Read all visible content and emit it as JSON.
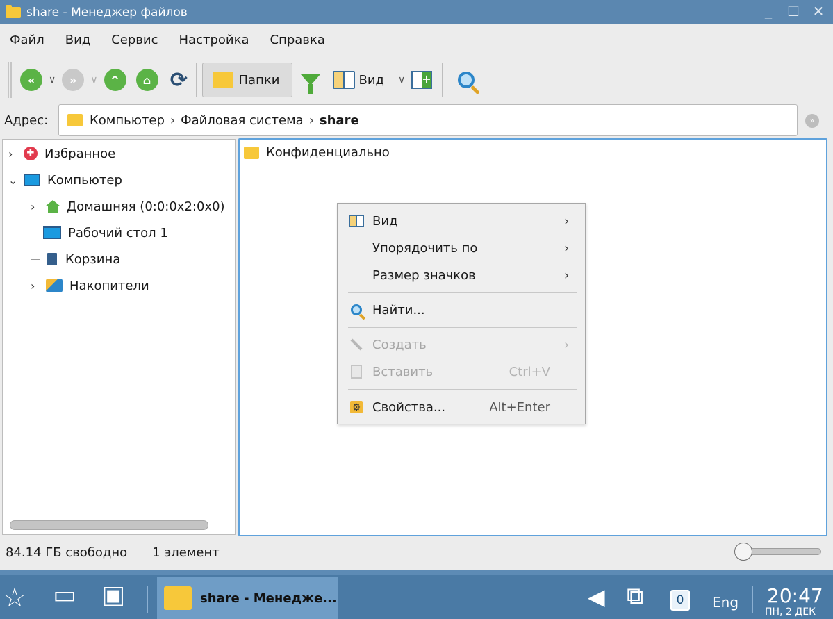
{
  "window": {
    "title": "share - Менеджер файлов",
    "controls": [
      "_",
      "☐",
      "✕"
    ]
  },
  "menubar": {
    "items": [
      "Файл",
      "Вид",
      "Сервис",
      "Настройка",
      "Справка"
    ]
  },
  "toolbar": {
    "folders_label": "Папки",
    "view_label": "Вид"
  },
  "address": {
    "label": "Адрес:",
    "crumbs": [
      "Компьютер",
      "Файловая система",
      "share"
    ]
  },
  "tree": {
    "items": [
      {
        "label": "Избранное",
        "icon": "heart-icon"
      },
      {
        "label": "Компьютер",
        "icon": "monitor-icon"
      },
      {
        "label": "Домашняя (0:0:0x2:0x0)",
        "icon": "home-icon"
      },
      {
        "label": "Рабочий стол 1",
        "icon": "desktop-icon"
      },
      {
        "label": "Корзина",
        "icon": "trash-icon"
      },
      {
        "label": "Накопители",
        "icon": "drives-icon"
      }
    ]
  },
  "files": {
    "items": [
      {
        "label": "Конфиденциально",
        "icon": "folder-icon"
      }
    ]
  },
  "context_menu": {
    "items": [
      {
        "label": "Вид",
        "has_submenu": true,
        "enabled": true
      },
      {
        "label": "Упорядочить по",
        "has_submenu": true,
        "enabled": true
      },
      {
        "label": "Размер значков",
        "has_submenu": true,
        "enabled": true
      },
      {
        "label": "Найти...",
        "enabled": true
      },
      {
        "label": "Создать",
        "has_submenu": true,
        "enabled": false
      },
      {
        "label": "Вставить",
        "shortcut": "Ctrl+V",
        "enabled": false
      },
      {
        "label": "Свойства...",
        "shortcut": "Alt+Enter",
        "enabled": true
      }
    ]
  },
  "status": {
    "free": "84.14 ГБ свободно",
    "count": "1 элемент"
  },
  "taskbar": {
    "task_label": "share - Менедже...",
    "desktop_number": "0",
    "language": "Eng",
    "time": "20:47",
    "date": "ПН, 2 ДЕК"
  },
  "colors": {
    "titlebar": "#5b87b0",
    "taskbar": "#4a7aa5",
    "accent_green": "#5bb346",
    "folder_yellow": "#f7c83a",
    "selection_border": "#5fa2dc"
  }
}
